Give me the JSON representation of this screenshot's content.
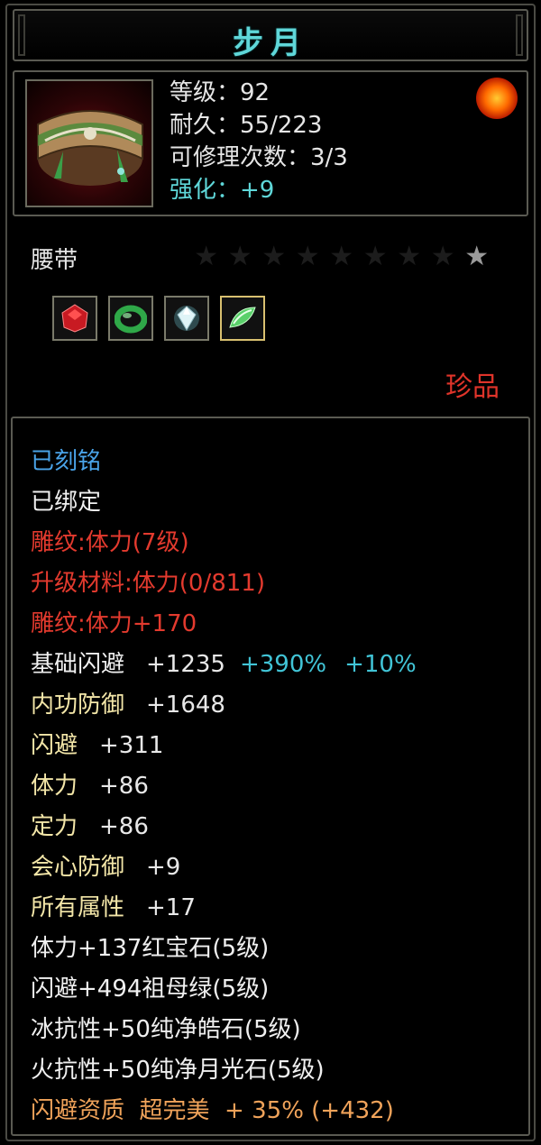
{
  "title": "步月",
  "stats": {
    "level": "等级：92",
    "durability": "耐久：55/223",
    "repair_times": "可修理次数：3/3",
    "enhance": "强化：+9"
  },
  "item_type": "腰带",
  "stars": {
    "total": 9,
    "lit": 1
  },
  "gems": [
    {
      "icon": "ruby-icon",
      "color": "#d8232a"
    },
    {
      "icon": "emerald-ring-icon",
      "color": "#39b24a"
    },
    {
      "icon": "diamond-icon",
      "color": "#cfe8ee"
    },
    {
      "icon": "jade-icon",
      "color": "#6fe07a"
    }
  ],
  "rarity": "珍品",
  "attributes": {
    "engraved": "已刻铭",
    "bound": "已绑定",
    "carving_level": "雕纹:体力(7级)",
    "upgrade_material": "升级材料:体力(0/811)",
    "carving_bonus": "雕纹:体力+170",
    "base_dodge": {
      "label": "基础闪避",
      "value": "+1235",
      "bonus1": "+390%",
      "bonus2": "+10%"
    },
    "inner_defense": {
      "label": "内功防御",
      "value": "+1648"
    },
    "dodge": {
      "label": "闪避",
      "value": "+311"
    },
    "stamina": {
      "label": "体力",
      "value": "+86"
    },
    "focus": {
      "label": "定力",
      "value": "+86"
    },
    "crit_defense": {
      "label": "会心防御",
      "value": "+9"
    },
    "all_attributes": {
      "label": "所有属性",
      "value": "+17"
    },
    "gem_line_1": "体力+137红宝石(5级)",
    "gem_line_2": "闪避+494祖母绿(5级)",
    "gem_line_3": "冰抗性+50纯净皓石(5级)",
    "gem_line_4": "火抗性+50纯净月光石(5级)",
    "quality": "闪避资质  超完美  + 35% (+432)"
  }
}
